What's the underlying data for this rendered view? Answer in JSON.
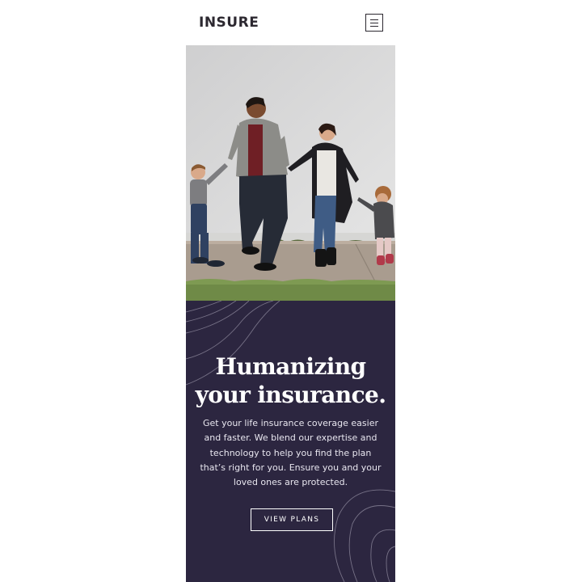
{
  "header": {
    "logo": "INSURE",
    "menu_icon": "hamburger-icon"
  },
  "hero": {
    "image": "family-walking-photo",
    "headline_line1": "Humanizing",
    "headline_line2": "your insurance.",
    "description": "Get your life insurance coverage easier and faster. We blend our expertise and technology to help you find the plan that’s right for you. Ensure you and your loved ones are protected.",
    "cta_label": "VIEW PLANS"
  },
  "colors": {
    "dark_violet": "#2c2640",
    "text_dark": "#2c2830",
    "white": "#ffffff"
  }
}
